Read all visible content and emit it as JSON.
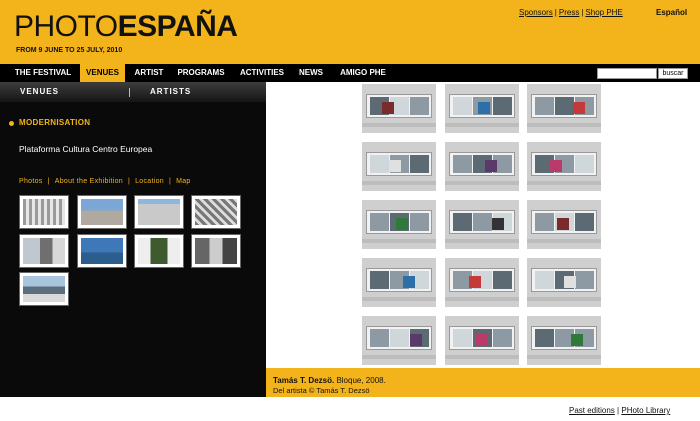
{
  "header": {
    "logo_light": "PHOTO",
    "logo_bold": "ESPAÑA",
    "dates": "FROM 9 JUNE TO 25 JULY, 2010",
    "links": [
      "Sponsors",
      "Press",
      "Shop PHE"
    ],
    "separator": "|",
    "language": "Español",
    "brand_color": "#f3b41b"
  },
  "nav": {
    "items": [
      "THE FESTIVAL",
      "VENUES",
      "ARTIST",
      "PROGRAMS",
      "ACTIVITIES",
      "NEWS",
      "AMIGO PHE"
    ],
    "active": "VENUES",
    "search_button": "buscar"
  },
  "subnav": {
    "venues": "VENUES",
    "artists": "ARTISTS"
  },
  "venue": {
    "section": "MODERNISATION",
    "name": "Plataforma Cultura Centro Europea",
    "tabs": [
      "Photos",
      "About the Exhibition",
      "Location",
      "Map"
    ]
  },
  "thumbnails": {
    "count": 9,
    "icons": [
      "photo-thumbnail"
    ]
  },
  "caption": {
    "artist": "Tamás T. Dezsö.",
    "title": " Bloque, 2008.",
    "credit": "Del artista © Tamás T. Dezsö"
  },
  "footer": {
    "links": [
      "Past editions",
      "PHoto Library"
    ],
    "separator": "|"
  }
}
